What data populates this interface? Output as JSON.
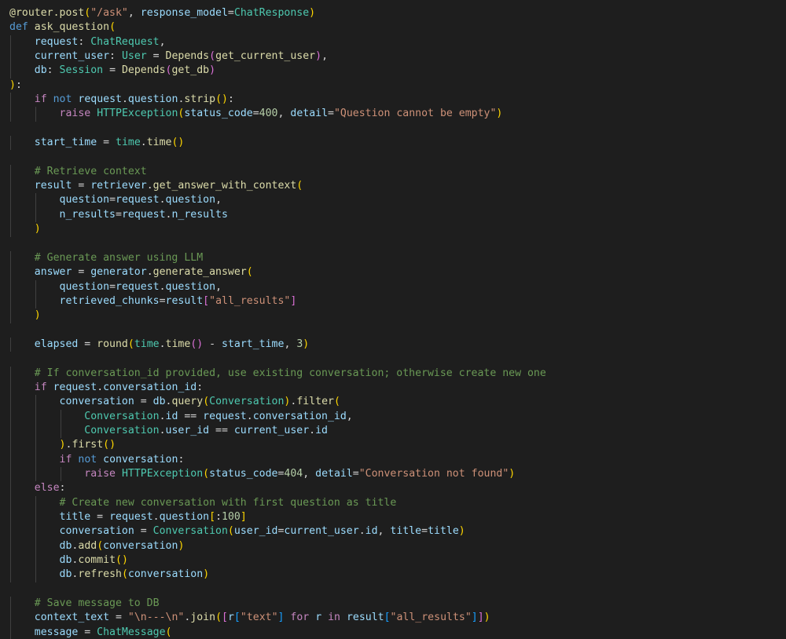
{
  "colors": {
    "background": "#1e1e1e",
    "decorator": "#dcdcaa",
    "keyword": "#569cd6",
    "control": "#c586c0",
    "function": "#dcdcaa",
    "class": "#4ec9b0",
    "variable": "#9cdcfe",
    "string": "#ce9178",
    "number": "#b5cea8",
    "comment": "#6a9955",
    "bracket1": "#ffd700",
    "bracket2": "#da70d6",
    "bracket3": "#179fff"
  },
  "code": {
    "lines": [
      {
        "indent": 0,
        "tokens": [
          [
            "deco",
            "@router.post"
          ],
          [
            "p1",
            "("
          ],
          [
            "str",
            "\"/ask\""
          ],
          [
            "plain",
            ", "
          ],
          [
            "var",
            "response_model"
          ],
          [
            "plain",
            "="
          ],
          [
            "cls",
            "ChatResponse"
          ],
          [
            "p1",
            ")"
          ]
        ]
      },
      {
        "indent": 0,
        "tokens": [
          [
            "kw",
            "def"
          ],
          [
            "plain",
            " "
          ],
          [
            "fn",
            "ask_question"
          ],
          [
            "p1",
            "("
          ]
        ]
      },
      {
        "indent": 1,
        "tokens": [
          [
            "var",
            "request"
          ],
          [
            "plain",
            ": "
          ],
          [
            "cls",
            "ChatRequest"
          ],
          [
            "plain",
            ","
          ]
        ]
      },
      {
        "indent": 1,
        "tokens": [
          [
            "var",
            "current_user"
          ],
          [
            "plain",
            ": "
          ],
          [
            "cls",
            "User"
          ],
          [
            "plain",
            " = "
          ],
          [
            "fn",
            "Depends"
          ],
          [
            "p2",
            "("
          ],
          [
            "fn",
            "get_current_user"
          ],
          [
            "p2",
            ")"
          ],
          [
            "plain",
            ","
          ]
        ]
      },
      {
        "indent": 1,
        "tokens": [
          [
            "var",
            "db"
          ],
          [
            "plain",
            ": "
          ],
          [
            "cls",
            "Session"
          ],
          [
            "plain",
            " = "
          ],
          [
            "fn",
            "Depends"
          ],
          [
            "p2",
            "("
          ],
          [
            "fn",
            "get_db"
          ],
          [
            "p2",
            ")"
          ]
        ]
      },
      {
        "indent": 0,
        "tokens": [
          [
            "p1",
            ")"
          ],
          [
            "plain",
            ":"
          ]
        ]
      },
      {
        "indent": 1,
        "tokens": [
          [
            "ctl",
            "if"
          ],
          [
            "plain",
            " "
          ],
          [
            "kw",
            "not"
          ],
          [
            "plain",
            " "
          ],
          [
            "var",
            "request"
          ],
          [
            "plain",
            "."
          ],
          [
            "var",
            "question"
          ],
          [
            "plain",
            "."
          ],
          [
            "fn",
            "strip"
          ],
          [
            "p1",
            "()"
          ],
          [
            "plain",
            ":"
          ]
        ]
      },
      {
        "indent": 2,
        "tokens": [
          [
            "ctl",
            "raise"
          ],
          [
            "plain",
            " "
          ],
          [
            "cls",
            "HTTPException"
          ],
          [
            "p1",
            "("
          ],
          [
            "var",
            "status_code"
          ],
          [
            "plain",
            "="
          ],
          [
            "num",
            "400"
          ],
          [
            "plain",
            ", "
          ],
          [
            "var",
            "detail"
          ],
          [
            "plain",
            "="
          ],
          [
            "str",
            "\"Question cannot be empty\""
          ],
          [
            "p1",
            ")"
          ]
        ]
      },
      {
        "indent": 0,
        "tokens": []
      },
      {
        "indent": 1,
        "tokens": [
          [
            "var",
            "start_time"
          ],
          [
            "plain",
            " = "
          ],
          [
            "cls",
            "time"
          ],
          [
            "plain",
            "."
          ],
          [
            "fn",
            "time"
          ],
          [
            "p1",
            "()"
          ]
        ]
      },
      {
        "indent": 0,
        "tokens": []
      },
      {
        "indent": 1,
        "tokens": [
          [
            "cmt",
            "# Retrieve context"
          ]
        ]
      },
      {
        "indent": 1,
        "tokens": [
          [
            "var",
            "result"
          ],
          [
            "plain",
            " = "
          ],
          [
            "var",
            "retriever"
          ],
          [
            "plain",
            "."
          ],
          [
            "fn",
            "get_answer_with_context"
          ],
          [
            "p1",
            "("
          ]
        ]
      },
      {
        "indent": 2,
        "tokens": [
          [
            "var",
            "question"
          ],
          [
            "plain",
            "="
          ],
          [
            "var",
            "request"
          ],
          [
            "plain",
            "."
          ],
          [
            "var",
            "question"
          ],
          [
            "plain",
            ","
          ]
        ]
      },
      {
        "indent": 2,
        "tokens": [
          [
            "var",
            "n_results"
          ],
          [
            "plain",
            "="
          ],
          [
            "var",
            "request"
          ],
          [
            "plain",
            "."
          ],
          [
            "var",
            "n_results"
          ]
        ]
      },
      {
        "indent": 1,
        "tokens": [
          [
            "p1",
            ")"
          ]
        ]
      },
      {
        "indent": 0,
        "tokens": []
      },
      {
        "indent": 1,
        "tokens": [
          [
            "cmt",
            "# Generate answer using LLM"
          ]
        ]
      },
      {
        "indent": 1,
        "tokens": [
          [
            "var",
            "answer"
          ],
          [
            "plain",
            " = "
          ],
          [
            "var",
            "generator"
          ],
          [
            "plain",
            "."
          ],
          [
            "fn",
            "generate_answer"
          ],
          [
            "p1",
            "("
          ]
        ]
      },
      {
        "indent": 2,
        "tokens": [
          [
            "var",
            "question"
          ],
          [
            "plain",
            "="
          ],
          [
            "var",
            "request"
          ],
          [
            "plain",
            "."
          ],
          [
            "var",
            "question"
          ],
          [
            "plain",
            ","
          ]
        ]
      },
      {
        "indent": 2,
        "tokens": [
          [
            "var",
            "retrieved_chunks"
          ],
          [
            "plain",
            "="
          ],
          [
            "var",
            "result"
          ],
          [
            "p2",
            "["
          ],
          [
            "str",
            "\"all_results\""
          ],
          [
            "p2",
            "]"
          ]
        ]
      },
      {
        "indent": 1,
        "tokens": [
          [
            "p1",
            ")"
          ]
        ]
      },
      {
        "indent": 0,
        "tokens": []
      },
      {
        "indent": 1,
        "tokens": [
          [
            "var",
            "elapsed"
          ],
          [
            "plain",
            " = "
          ],
          [
            "fn",
            "round"
          ],
          [
            "p1",
            "("
          ],
          [
            "cls",
            "time"
          ],
          [
            "plain",
            "."
          ],
          [
            "fn",
            "time"
          ],
          [
            "p2",
            "()"
          ],
          [
            "plain",
            " - "
          ],
          [
            "var",
            "start_time"
          ],
          [
            "plain",
            ", "
          ],
          [
            "num",
            "3"
          ],
          [
            "p1",
            ")"
          ]
        ]
      },
      {
        "indent": 0,
        "tokens": []
      },
      {
        "indent": 1,
        "tokens": [
          [
            "cmt",
            "# If conversation_id provided, use existing conversation; otherwise create new one"
          ]
        ]
      },
      {
        "indent": 1,
        "tokens": [
          [
            "ctl",
            "if"
          ],
          [
            "plain",
            " "
          ],
          [
            "var",
            "request"
          ],
          [
            "plain",
            "."
          ],
          [
            "var",
            "conversation_id"
          ],
          [
            "plain",
            ":"
          ]
        ]
      },
      {
        "indent": 2,
        "tokens": [
          [
            "var",
            "conversation"
          ],
          [
            "plain",
            " = "
          ],
          [
            "var",
            "db"
          ],
          [
            "plain",
            "."
          ],
          [
            "fn",
            "query"
          ],
          [
            "p1",
            "("
          ],
          [
            "cls",
            "Conversation"
          ],
          [
            "p1",
            ")"
          ],
          [
            "plain",
            "."
          ],
          [
            "fn",
            "filter"
          ],
          [
            "p1",
            "("
          ]
        ]
      },
      {
        "indent": 3,
        "tokens": [
          [
            "cls",
            "Conversation"
          ],
          [
            "plain",
            "."
          ],
          [
            "var",
            "id"
          ],
          [
            "plain",
            " == "
          ],
          [
            "var",
            "request"
          ],
          [
            "plain",
            "."
          ],
          [
            "var",
            "conversation_id"
          ],
          [
            "plain",
            ","
          ]
        ]
      },
      {
        "indent": 3,
        "tokens": [
          [
            "cls",
            "Conversation"
          ],
          [
            "plain",
            "."
          ],
          [
            "var",
            "user_id"
          ],
          [
            "plain",
            " == "
          ],
          [
            "var",
            "current_user"
          ],
          [
            "plain",
            "."
          ],
          [
            "var",
            "id"
          ]
        ]
      },
      {
        "indent": 2,
        "tokens": [
          [
            "p1",
            ")"
          ],
          [
            "plain",
            "."
          ],
          [
            "fn",
            "first"
          ],
          [
            "p1",
            "()"
          ]
        ]
      },
      {
        "indent": 2,
        "tokens": [
          [
            "ctl",
            "if"
          ],
          [
            "plain",
            " "
          ],
          [
            "kw",
            "not"
          ],
          [
            "plain",
            " "
          ],
          [
            "var",
            "conversation"
          ],
          [
            "plain",
            ":"
          ]
        ]
      },
      {
        "indent": 3,
        "tokens": [
          [
            "ctl",
            "raise"
          ],
          [
            "plain",
            " "
          ],
          [
            "cls",
            "HTTPException"
          ],
          [
            "p1",
            "("
          ],
          [
            "var",
            "status_code"
          ],
          [
            "plain",
            "="
          ],
          [
            "num",
            "404"
          ],
          [
            "plain",
            ", "
          ],
          [
            "var",
            "detail"
          ],
          [
            "plain",
            "="
          ],
          [
            "str",
            "\"Conversation not found\""
          ],
          [
            "p1",
            ")"
          ]
        ]
      },
      {
        "indent": 1,
        "tokens": [
          [
            "ctl",
            "else"
          ],
          [
            "plain",
            ":"
          ]
        ]
      },
      {
        "indent": 2,
        "tokens": [
          [
            "cmt",
            "# Create new conversation with first question as title"
          ]
        ]
      },
      {
        "indent": 2,
        "tokens": [
          [
            "var",
            "title"
          ],
          [
            "plain",
            " = "
          ],
          [
            "var",
            "request"
          ],
          [
            "plain",
            "."
          ],
          [
            "var",
            "question"
          ],
          [
            "p1",
            "["
          ],
          [
            "plain",
            ":"
          ],
          [
            "num",
            "100"
          ],
          [
            "p1",
            "]"
          ]
        ]
      },
      {
        "indent": 2,
        "tokens": [
          [
            "var",
            "conversation"
          ],
          [
            "plain",
            " = "
          ],
          [
            "cls",
            "Conversation"
          ],
          [
            "p1",
            "("
          ],
          [
            "var",
            "user_id"
          ],
          [
            "plain",
            "="
          ],
          [
            "var",
            "current_user"
          ],
          [
            "plain",
            "."
          ],
          [
            "var",
            "id"
          ],
          [
            "plain",
            ", "
          ],
          [
            "var",
            "title"
          ],
          [
            "plain",
            "="
          ],
          [
            "var",
            "title"
          ],
          [
            "p1",
            ")"
          ]
        ]
      },
      {
        "indent": 2,
        "tokens": [
          [
            "var",
            "db"
          ],
          [
            "plain",
            "."
          ],
          [
            "fn",
            "add"
          ],
          [
            "p1",
            "("
          ],
          [
            "var",
            "conversation"
          ],
          [
            "p1",
            ")"
          ]
        ]
      },
      {
        "indent": 2,
        "tokens": [
          [
            "var",
            "db"
          ],
          [
            "plain",
            "."
          ],
          [
            "fn",
            "commit"
          ],
          [
            "p1",
            "()"
          ]
        ]
      },
      {
        "indent": 2,
        "tokens": [
          [
            "var",
            "db"
          ],
          [
            "plain",
            "."
          ],
          [
            "fn",
            "refresh"
          ],
          [
            "p1",
            "("
          ],
          [
            "var",
            "conversation"
          ],
          [
            "p1",
            ")"
          ]
        ]
      },
      {
        "indent": 0,
        "tokens": []
      },
      {
        "indent": 1,
        "tokens": [
          [
            "cmt",
            "# Save message to DB"
          ]
        ]
      },
      {
        "indent": 1,
        "tokens": [
          [
            "var",
            "context_text"
          ],
          [
            "plain",
            " = "
          ],
          [
            "str",
            "\"\\n---\\n\""
          ],
          [
            "plain",
            "."
          ],
          [
            "fn",
            "join"
          ],
          [
            "p1",
            "("
          ],
          [
            "p2",
            "["
          ],
          [
            "var",
            "r"
          ],
          [
            "p3",
            "["
          ],
          [
            "str",
            "\"text\""
          ],
          [
            "p3",
            "]"
          ],
          [
            "plain",
            " "
          ],
          [
            "ctl",
            "for"
          ],
          [
            "plain",
            " "
          ],
          [
            "var",
            "r"
          ],
          [
            "plain",
            " "
          ],
          [
            "ctl",
            "in"
          ],
          [
            "plain",
            " "
          ],
          [
            "var",
            "result"
          ],
          [
            "p3",
            "["
          ],
          [
            "str",
            "\"all_results\""
          ],
          [
            "p3",
            "]"
          ],
          [
            "p2",
            "]"
          ],
          [
            "p1",
            ")"
          ]
        ]
      },
      {
        "indent": 1,
        "tokens": [
          [
            "var",
            "message"
          ],
          [
            "plain",
            " = "
          ],
          [
            "cls",
            "ChatMessage"
          ],
          [
            "p1",
            "("
          ]
        ]
      }
    ]
  }
}
